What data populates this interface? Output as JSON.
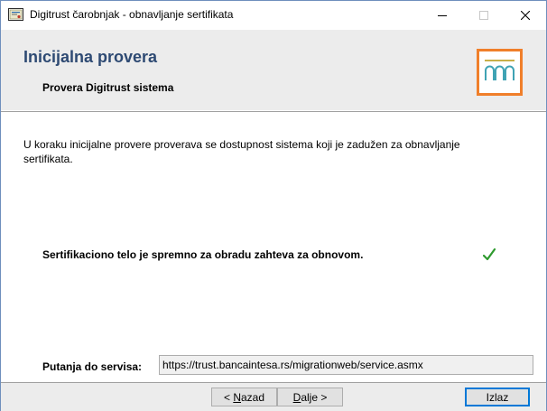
{
  "window": {
    "title": "Digitrust čarobnjak - obnavljanje sertifikata",
    "icons": {
      "app": "certificate-app-icon",
      "minimize": "minimize-icon",
      "maximize": "maximize-icon",
      "close": "close-icon"
    }
  },
  "header": {
    "title": "Inicijalna provera",
    "subtitle": "Provera Digitrust sistema",
    "logo_icon": "digitrust-logo-icon"
  },
  "body": {
    "intro": "U koraku inicijalne provere proverava se dostupnost sistema koji je zadužen za obnavljanje sertifikata.",
    "status": "Sertifikaciono telo je spremno za obradu zahteva za obnovom.",
    "status_icon": "checkmark-icon",
    "service_label": "Putanja do servisa:",
    "service_url": "https://trust.bancaintesa.rs/migrationweb/service.asmx"
  },
  "footer": {
    "back_prefix": "< ",
    "back_hotkey": "N",
    "back_rest": "azad",
    "next_hotkey": "D",
    "next_rest": "alje >",
    "exit": "Izlaz"
  },
  "colors": {
    "header_title": "#2e4a73",
    "logo_orange": "#f07f2a",
    "logo_teal": "#3fa3b4",
    "check_green": "#2e9a2e",
    "default_button_border": "#0078d7"
  }
}
